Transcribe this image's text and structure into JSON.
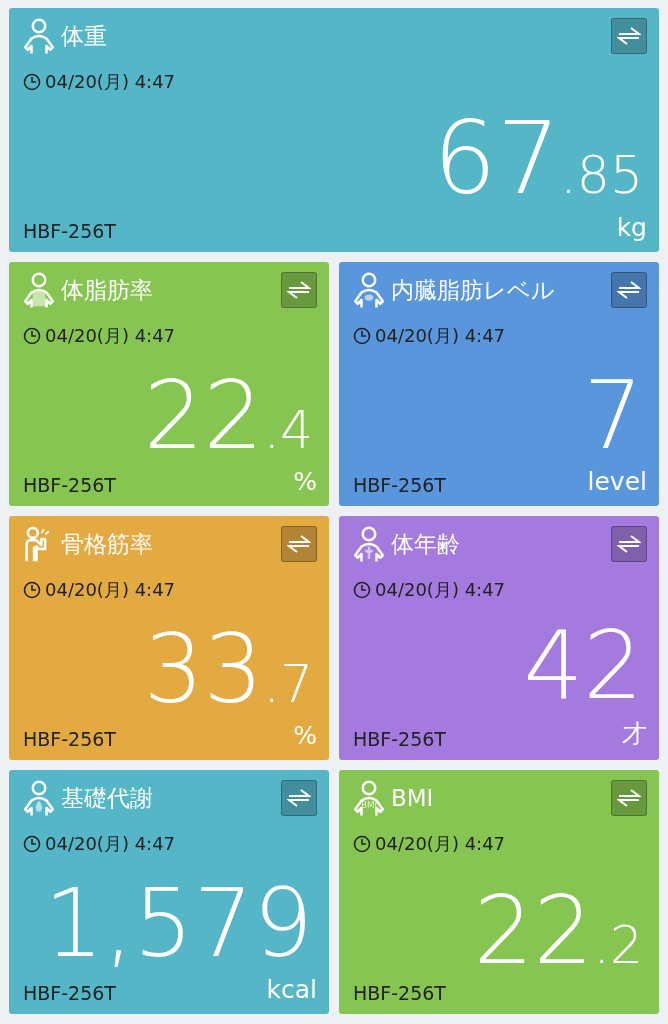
{
  "cards": [
    {
      "title": "体重",
      "kind": "person",
      "color": "#55b6c8",
      "date": "04/20(月) 4:47",
      "value_main": "67",
      "value_fraction": ".85",
      "model": "HBF-256T",
      "unit": "kg",
      "wide": true
    },
    {
      "title": "体脂肪率",
      "kind": "fat",
      "color": "#86c551",
      "date": "04/20(月) 4:47",
      "value_main": "22",
      "value_fraction": ".4",
      "model": "HBF-256T",
      "unit": "%",
      "wide": false
    },
    {
      "title": "内臓脂肪レベル",
      "kind": "visceral",
      "color": "#5a96dc",
      "date": "04/20(月) 4:47",
      "value_main": "7",
      "model": "HBF-256T",
      "unit": "level",
      "wide": false
    },
    {
      "title": "骨格筋率",
      "kind": "muscle",
      "color": "#e4aa42",
      "date": "04/20(月) 4:47",
      "value_main": "33",
      "value_fraction": ".7",
      "model": "HBF-256T",
      "unit": "%",
      "wide": false
    },
    {
      "title": "体年齢",
      "kind": "age",
      "color": "#a57ade",
      "date": "04/20(月) 4:47",
      "value_main": "42",
      "model": "HBF-256T",
      "unit": "才",
      "wide": false
    },
    {
      "title": "基礎代謝",
      "kind": "metabolism",
      "color": "#55b6c8",
      "date": "04/20(月) 4:47",
      "value_main": "1,579",
      "model": "HBF-256T",
      "unit": "kcal",
      "wide": false
    },
    {
      "title": "BMI",
      "kind": "bmi",
      "icon_text": "BMI",
      "color": "#86c551",
      "date": "04/20(月) 4:47",
      "value_main": "22",
      "value_fraction": ".2",
      "model": "HBF-256T",
      "wide": false
    }
  ]
}
